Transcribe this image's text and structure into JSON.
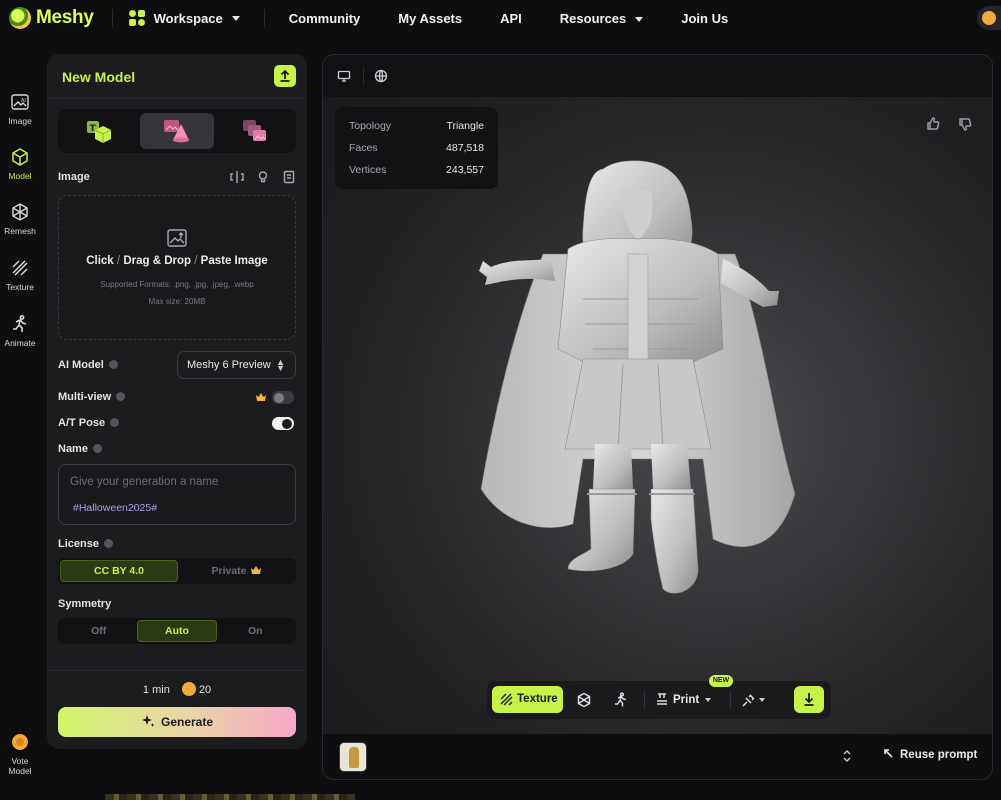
{
  "app": {
    "name": "Meshy"
  },
  "topnav": {
    "workspace": "Workspace",
    "links": [
      "Community",
      "My Assets",
      "API",
      "Resources",
      "Join Us"
    ]
  },
  "rail": {
    "items": [
      {
        "label": "Image",
        "icon": "image-ai-icon"
      },
      {
        "label": "Model",
        "icon": "cube-icon"
      },
      {
        "label": "Remesh",
        "icon": "remesh-icon"
      },
      {
        "label": "Texture",
        "icon": "texture-icon"
      },
      {
        "label": "Animate",
        "icon": "running-figure-icon"
      }
    ],
    "vote": {
      "line1": "Vote",
      "line2": "Model"
    }
  },
  "panel": {
    "title": "New Model",
    "image_label": "Image",
    "dropzone": {
      "click": "Click",
      "drag": "Drag & Drop",
      "paste": "Paste Image",
      "formats": "Supported Formats: .png, .jpg, .jpeg, .webp",
      "max_size": "Max size: 20MB"
    },
    "ai_model_label": "AI Model",
    "ai_model_value": "Meshy 6 Preview",
    "multiview_label": "Multi-view",
    "multiview_on": false,
    "atpose_label": "A/T Pose",
    "atpose_on": true,
    "name_label": "Name",
    "name_placeholder": "Give your generation a name",
    "name_tag": "#Halloween2025#",
    "license_label": "License",
    "license_options": [
      "CC BY 4.0",
      "Private"
    ],
    "license_selected": "CC BY 4.0",
    "symmetry_label": "Symmetry",
    "symmetry_options": [
      "Off",
      "Auto",
      "On"
    ],
    "symmetry_selected": "Auto",
    "time": "1 min",
    "credits": "20",
    "generate_label": "Generate"
  },
  "viewer": {
    "stats": [
      {
        "label": "Topology",
        "value": "Triangle"
      },
      {
        "label": "Faces",
        "value": "487,518"
      },
      {
        "label": "Vertices",
        "value": "243,557"
      }
    ],
    "toolbar": {
      "texture": "Texture",
      "print": "Print",
      "new_badge": "NEW"
    },
    "reuse_prompt": "Reuse prompt"
  },
  "colors": {
    "accent": "#c6f24a",
    "coin": "#f2a93b",
    "panel": "#1c1c1f"
  }
}
